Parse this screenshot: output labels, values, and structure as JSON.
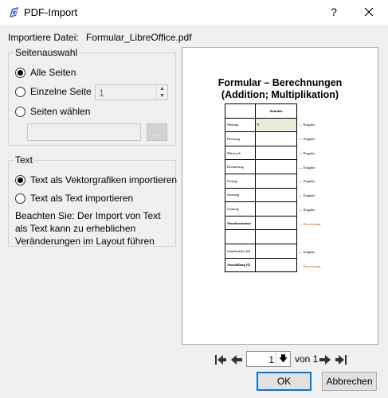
{
  "window": {
    "title": "PDF-Import",
    "help_label": "?"
  },
  "file": {
    "label": "Importiere Datei:",
    "name": "Formular_LibreOffice.pdf"
  },
  "pages": {
    "group_label": "Seitenauswahl",
    "all_label": "Alle Seiten",
    "single_label": "Einzelne Seite",
    "single_value": "1",
    "choose_label": "Seiten wählen",
    "range_value": "",
    "dots_label": "..."
  },
  "text": {
    "group_label": "Text",
    "vector_label": "Text als Vektorgrafiken importieren",
    "text_label": "Text als Text importieren",
    "note": "Beachten Sie: Der Import von Text als Text kann zu erheblichen Veränderungen im Layout führen"
  },
  "preview": {
    "title_line1": "Formular – Berechnungen",
    "title_line2": "(Addition; Multiplikation)",
    "header": "Stunden",
    "first_value": "0",
    "rows": [
      "Montag",
      "Dienstag",
      "Mittwoch",
      "Donnerstag",
      "Freitag",
      "Samstag",
      "Sonntag",
      "Stundensumme",
      "",
      "Stundenlohn (€)",
      "Auszahlung (€)"
    ],
    "annotations": {
      "eingabe": "← Eingabe",
      "berechnung": "← Berechnung"
    }
  },
  "nav": {
    "current_page": "1",
    "of_label": "von 1"
  },
  "buttons": {
    "ok": "OK",
    "cancel": "Abbrechen"
  },
  "colors": {
    "accent": "#0078d7",
    "annotation_orange": "#c05a00"
  }
}
